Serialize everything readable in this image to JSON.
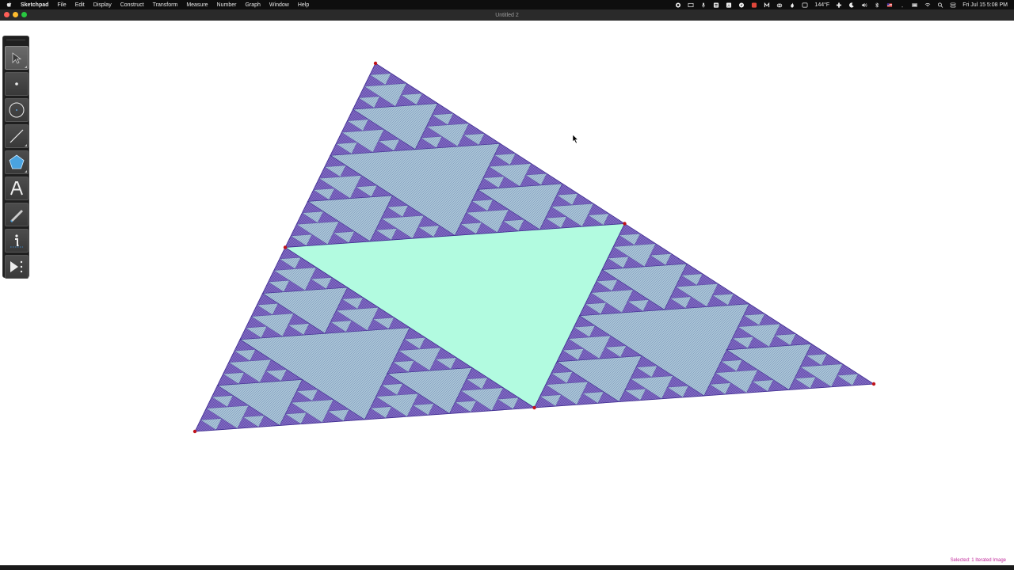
{
  "menubar": {
    "app_name": "Sketchpad",
    "items": [
      "File",
      "Edit",
      "Display",
      "Construct",
      "Transform",
      "Measure",
      "Number",
      "Graph",
      "Window",
      "Help"
    ],
    "temperature": "144°F",
    "datetime": "Fri Jul 15  5:08 PM"
  },
  "window": {
    "title": "Untitled 2"
  },
  "toolbox": {
    "tools": [
      "arrow-select-tool",
      "point-tool",
      "compass-tool",
      "straightedge-tool",
      "polygon-tool",
      "text-tool",
      "marker-tool",
      "information-tool",
      "custom-tool"
    ],
    "active": "arrow-select-tool"
  },
  "status": {
    "text": "Selected: 1 Iterated Image"
  },
  "colors": {
    "fractal_fill": "#8b74c9",
    "fractal_stroke": "#3d2a8f",
    "center_triangle": "#b2fbe0",
    "hatch_triangle": "#a8c6d8",
    "point": "#c0141b"
  }
}
